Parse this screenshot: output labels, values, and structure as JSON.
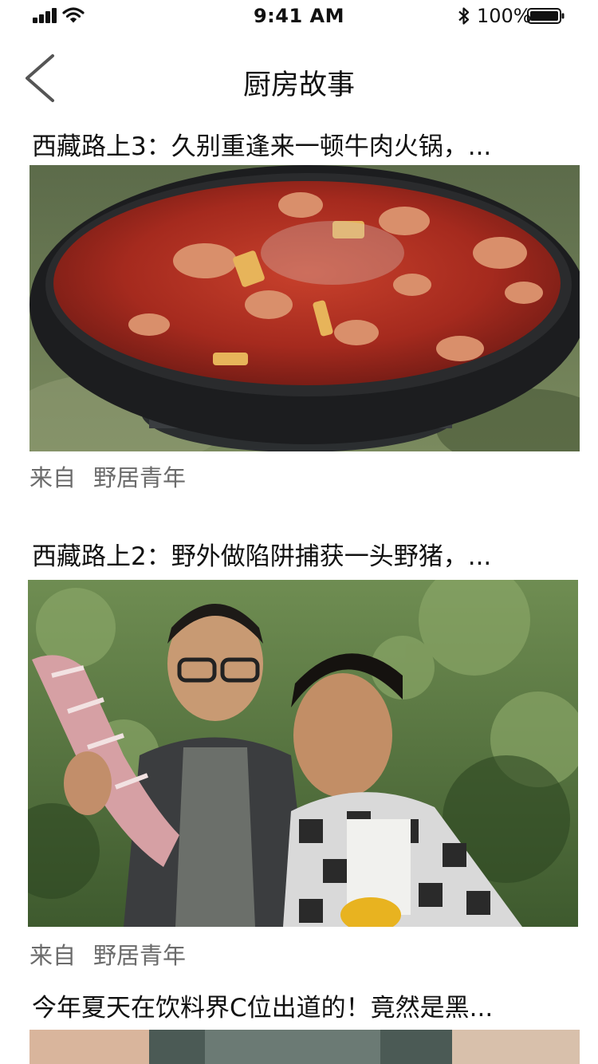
{
  "status_bar": {
    "time": "9:41 AM",
    "battery_percent": "100%",
    "icons": [
      "signal-icon",
      "wifi-icon",
      "bluetooth-icon",
      "battery-icon"
    ]
  },
  "nav": {
    "back_icon": "chevron-left-icon",
    "title": "厨房故事"
  },
  "articles": [
    {
      "title": "西藏路上3：久别重逢来一顿牛肉火锅，...",
      "source_prefix": "来自",
      "source_name": "野居青年"
    },
    {
      "title": "西藏路上2：野外做陷阱捕获一头野猪，...",
      "source_prefix": "来自",
      "source_name": "野居青年"
    },
    {
      "title": "今年夏天在饮料界C位出道的！竟然是黑..."
    }
  ],
  "colors": {
    "text_primary": "#111111",
    "text_secondary": "#6b6b6b",
    "background": "#ffffff"
  }
}
